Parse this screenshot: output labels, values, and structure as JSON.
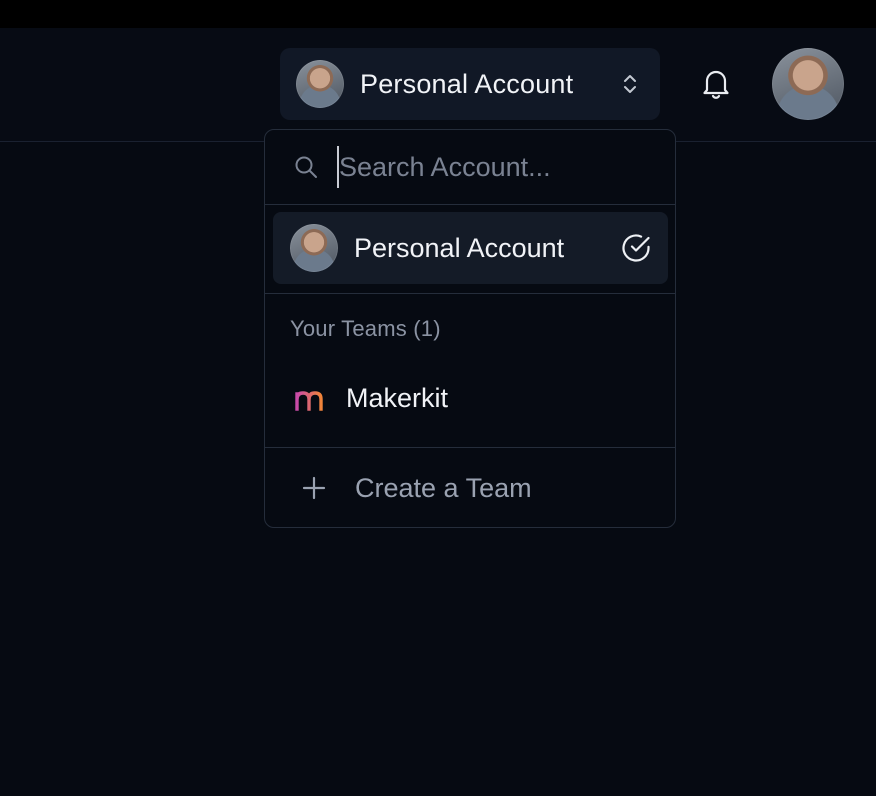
{
  "header": {
    "account_switcher": {
      "label": "Personal Account",
      "icon": "chevrons-up-down-icon"
    },
    "notifications": {
      "icon": "bell-icon"
    },
    "user_menu": {
      "icon": "avatar"
    }
  },
  "dropdown": {
    "search": {
      "value": "",
      "placeholder": "Search Account..."
    },
    "personal_account": {
      "label": "Personal Account",
      "selected": true,
      "icon": "check-circle-icon"
    },
    "teams_group": {
      "label": "Your Teams (1)",
      "items": [
        {
          "label": "Makerkit",
          "logo_letter": "m"
        }
      ]
    },
    "create_team": {
      "label": "Create a Team",
      "icon": "plus-icon"
    }
  },
  "colors": {
    "background": "#060a12",
    "trigger_bg": "#111826",
    "selected_item_bg": "#141b27",
    "border": "#252d3b",
    "muted_text": "#8b93a3",
    "logo_gradient_start": "#c74aa8",
    "logo_gradient_end": "#f0843a"
  }
}
